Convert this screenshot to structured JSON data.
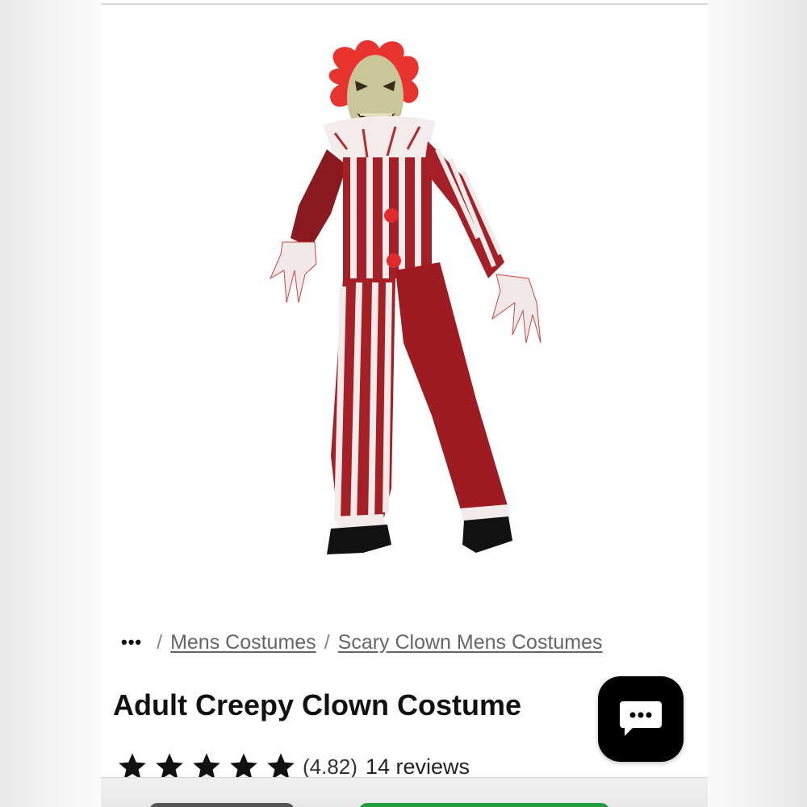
{
  "breadcrumb": {
    "more": "•••",
    "separator": "/",
    "items": [
      "Mens Costumes",
      "Scary Clown Mens Costumes"
    ]
  },
  "product": {
    "title": "Adult Creepy Clown Costume",
    "rating_value": "(4.82)",
    "rating_fraction": 0.964,
    "stars_filled": 5,
    "review_count": "14 reviews"
  },
  "chat": {
    "icon": "chat-bubble-icon"
  },
  "colors": {
    "accent_green": "#1f9d3a",
    "star": "#111111",
    "costume_red": "#9e1b22"
  }
}
